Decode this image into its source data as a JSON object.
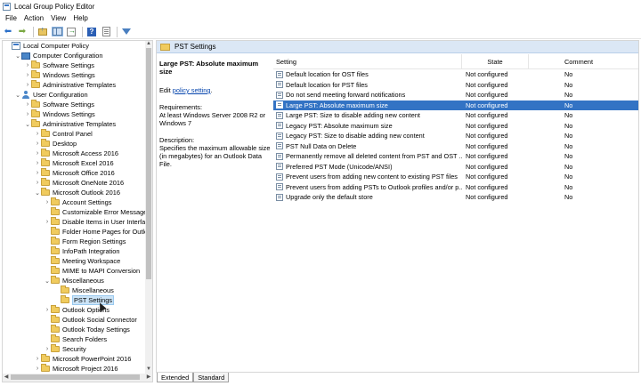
{
  "window": {
    "title": "Local Group Policy Editor",
    "icon": "group-policy-icon"
  },
  "menu": [
    "File",
    "Action",
    "View",
    "Help"
  ],
  "toolbar": {
    "buttons": [
      "back-arrow-icon",
      "forward-arrow-icon",
      "up-folder-icon",
      "show-hide-tree-icon",
      "export-list-icon",
      "help-icon",
      "properties-sheet-icon",
      "filter-icon"
    ]
  },
  "tree": {
    "nodes": [
      {
        "label": "Local Computer Policy",
        "level": 0,
        "icon": "policy",
        "chevron": ""
      },
      {
        "label": "Computer Configuration",
        "level": 1,
        "icon": "computer",
        "chevron": "⌄"
      },
      {
        "label": "Software Settings",
        "level": 2,
        "icon": "folder",
        "chevron": "›"
      },
      {
        "label": "Windows Settings",
        "level": 2,
        "icon": "folder",
        "chevron": "›"
      },
      {
        "label": "Administrative Templates",
        "level": 2,
        "icon": "folder",
        "chevron": "›"
      },
      {
        "label": "User Configuration",
        "level": 1,
        "icon": "user",
        "chevron": "⌄"
      },
      {
        "label": "Software Settings",
        "level": 2,
        "icon": "folder",
        "chevron": "›"
      },
      {
        "label": "Windows Settings",
        "level": 2,
        "icon": "folder",
        "chevron": "›"
      },
      {
        "label": "Administrative Templates",
        "level": 2,
        "icon": "folder",
        "chevron": "⌄"
      },
      {
        "label": "Control Panel",
        "level": 3,
        "icon": "folder",
        "chevron": "›"
      },
      {
        "label": "Desktop",
        "level": 3,
        "icon": "folder",
        "chevron": "›"
      },
      {
        "label": "Microsoft Access 2016",
        "level": 3,
        "icon": "folder",
        "chevron": "›"
      },
      {
        "label": "Microsoft Excel 2016",
        "level": 3,
        "icon": "folder",
        "chevron": "›"
      },
      {
        "label": "Microsoft Office 2016",
        "level": 3,
        "icon": "folder",
        "chevron": "›"
      },
      {
        "label": "Microsoft OneNote 2016",
        "level": 3,
        "icon": "folder",
        "chevron": "›"
      },
      {
        "label": "Microsoft Outlook 2016",
        "level": 3,
        "icon": "folder",
        "chevron": "⌄"
      },
      {
        "label": "Account Settings",
        "level": 4,
        "icon": "folder",
        "chevron": "›"
      },
      {
        "label": "Customizable Error Messages",
        "level": 4,
        "icon": "folder",
        "chevron": ""
      },
      {
        "label": "Disable Items in User Interface",
        "level": 4,
        "icon": "folder",
        "chevron": "›"
      },
      {
        "label": "Folder Home Pages for Outloo",
        "level": 4,
        "icon": "folder",
        "chevron": ""
      },
      {
        "label": "Form Region Settings",
        "level": 4,
        "icon": "folder",
        "chevron": ""
      },
      {
        "label": "InfoPath Integration",
        "level": 4,
        "icon": "folder",
        "chevron": ""
      },
      {
        "label": "Meeting Workspace",
        "level": 4,
        "icon": "folder",
        "chevron": ""
      },
      {
        "label": "MIME to MAPI Conversion",
        "level": 4,
        "icon": "folder",
        "chevron": ""
      },
      {
        "label": "Miscellaneous",
        "level": 4,
        "icon": "folder",
        "chevron": "⌄"
      },
      {
        "label": "Miscellaneous",
        "level": 5,
        "icon": "folder",
        "chevron": ""
      },
      {
        "label": "PST Settings",
        "level": 5,
        "icon": "folder",
        "chevron": "",
        "selected": true
      },
      {
        "label": "Outlook Options",
        "level": 4,
        "icon": "folder",
        "chevron": "›"
      },
      {
        "label": "Outlook Social Connector",
        "level": 4,
        "icon": "folder",
        "chevron": ""
      },
      {
        "label": "Outlook Today Settings",
        "level": 4,
        "icon": "folder",
        "chevron": ""
      },
      {
        "label": "Search Folders",
        "level": 4,
        "icon": "folder",
        "chevron": ""
      },
      {
        "label": "Security",
        "level": 4,
        "icon": "folder",
        "chevron": "›"
      },
      {
        "label": "Microsoft PowerPoint 2016",
        "level": 3,
        "icon": "folder",
        "chevron": "›"
      },
      {
        "label": "Microsoft Project 2016",
        "level": 3,
        "icon": "folder",
        "chevron": "›"
      }
    ]
  },
  "details": {
    "header": "PST Settings",
    "policy_title": "Large PST: Absolute maximum size",
    "edit_prefix": "Edit ",
    "edit_link": "policy setting",
    "edit_suffix": ".",
    "requirements_label": "Requirements:",
    "requirements_text": "At least Windows Server 2008 R2 or Windows 7",
    "description_label": "Description:",
    "description_text": "Specifies the maximum allowable size (in megabytes) for an Outlook Data File."
  },
  "list": {
    "columns": {
      "setting": "Setting",
      "state": "State",
      "comment": "Comment"
    },
    "rows": [
      {
        "setting": "Default location for OST files",
        "state": "Not configured",
        "comment": "No"
      },
      {
        "setting": "Default location for PST files",
        "state": "Not configured",
        "comment": "No"
      },
      {
        "setting": "Do not send meeting forward notifications",
        "state": "Not configured",
        "comment": "No"
      },
      {
        "setting": "Large PST: Absolute maximum size",
        "state": "Not configured",
        "comment": "No",
        "selected": true
      },
      {
        "setting": "Large PST: Size to disable adding new content",
        "state": "Not configured",
        "comment": "No"
      },
      {
        "setting": "Legacy PST: Absolute maximum size",
        "state": "Not configured",
        "comment": "No"
      },
      {
        "setting": "Legacy PST: Size to disable adding new content",
        "state": "Not configured",
        "comment": "No"
      },
      {
        "setting": "PST Null Data on Delete",
        "state": "Not configured",
        "comment": "No"
      },
      {
        "setting": "Permanently remove all deleted content from PST and OST ...",
        "state": "Not configured",
        "comment": "No"
      },
      {
        "setting": "Preferred PST Mode (Unicode/ANSI)",
        "state": "Not configured",
        "comment": "No"
      },
      {
        "setting": "Prevent users from adding new content to existing PST files",
        "state": "Not configured",
        "comment": "No"
      },
      {
        "setting": "Prevent users from adding PSTs to Outlook profiles and/or p...",
        "state": "Not configured",
        "comment": "No"
      },
      {
        "setting": "Upgrade only the default store",
        "state": "Not configured",
        "comment": "No"
      }
    ]
  },
  "tabs": [
    "Extended",
    "Standard"
  ],
  "colors": {
    "selection": "#3373c4",
    "header_band": "#dbe7f5",
    "link": "#0645ad"
  }
}
